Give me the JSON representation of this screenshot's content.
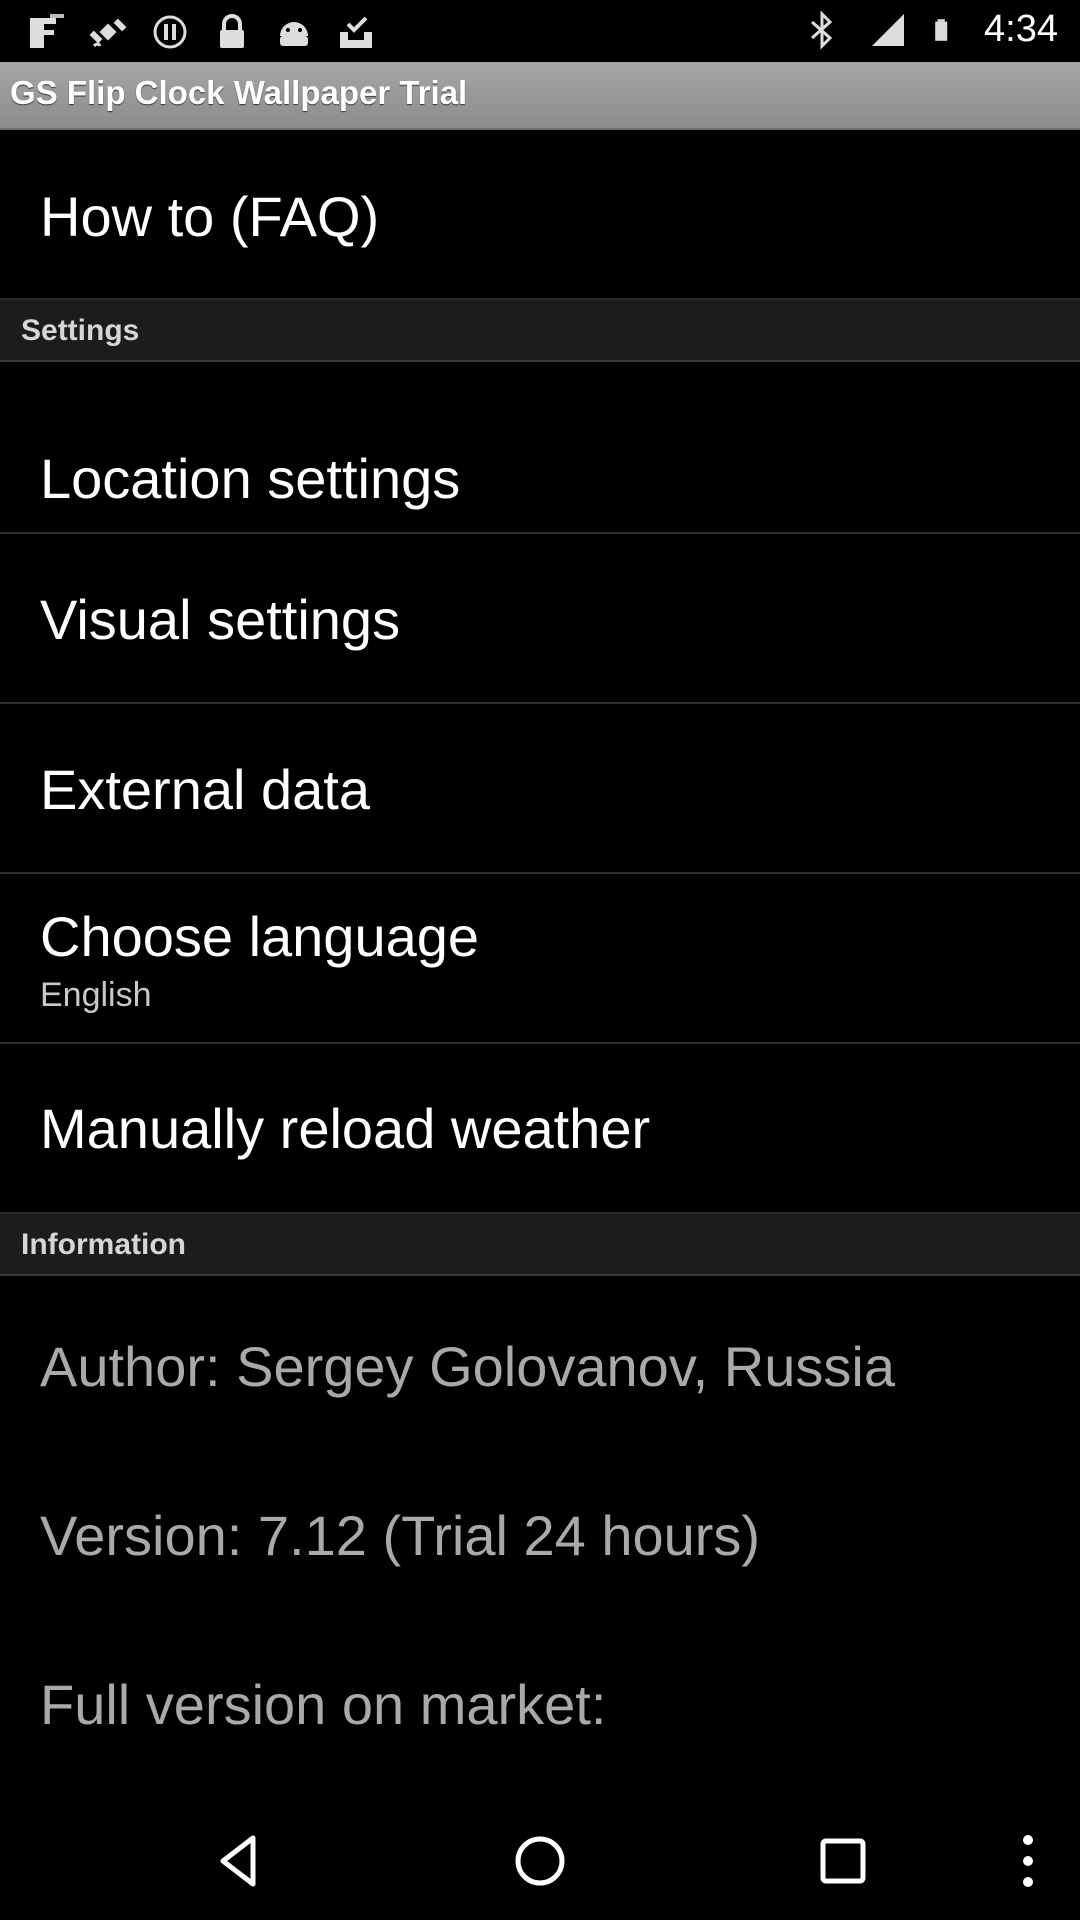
{
  "status_bar": {
    "time": "4:34",
    "left_icons": [
      "fake-gps-icon",
      "satellite-icon",
      "record-icon",
      "lock-icon",
      "android-icon",
      "download-done-icon"
    ],
    "right_icons": [
      "bluetooth-icon",
      "signal-icon",
      "battery-icon"
    ]
  },
  "app": {
    "title": "GS Flip Clock Wallpaper Trial"
  },
  "items": {
    "faq": "How to (FAQ)",
    "settings_header": "Settings",
    "location": "Location settings",
    "visual": "Visual settings",
    "external": "External data",
    "language": "Choose language",
    "language_value": "English",
    "reload": "Manually reload weather",
    "information_header": "Information",
    "author": "Author: Sergey Golovanov, Russia",
    "version": "Version: 7.12 (Trial 24 hours)",
    "market": "Full version on market:"
  },
  "nav": {
    "icons": [
      "back-icon",
      "home-icon",
      "recents-icon",
      "overflow-menu-icon"
    ]
  }
}
